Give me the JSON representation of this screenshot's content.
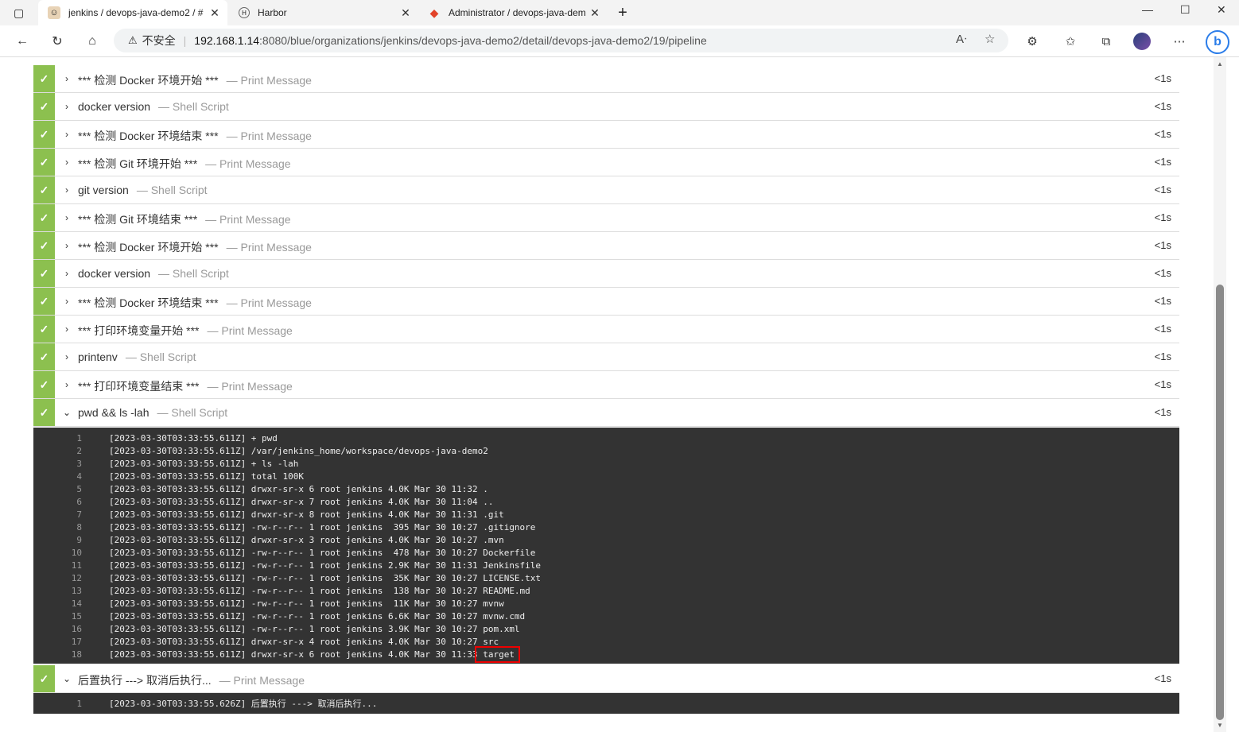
{
  "browser": {
    "tabs": [
      {
        "title": "jenkins / devops-java-demo2 / #",
        "close": "✕"
      },
      {
        "title": "Harbor",
        "close": "✕"
      },
      {
        "title": "Administrator / devops-java-dem",
        "close": "✕"
      }
    ],
    "new_tab": "+",
    "address": {
      "warning_icon": "warning-icon",
      "insecure_label": "不安全",
      "host": "192.168.1.14",
      "path": ":8080/blue/organizations/jenkins/devops-java-demo2/detail/devops-java-demo2/19/pipeline"
    }
  },
  "pipeline": {
    "steps": [
      {
        "label": "*** 检测 Docker 环境开始 ***",
        "type": "— Print Message",
        "duration": "<1s",
        "expanded": false
      },
      {
        "label": "docker version",
        "type": "— Shell Script",
        "duration": "<1s",
        "expanded": false
      },
      {
        "label": "*** 检测 Docker 环境结束 ***",
        "type": "— Print Message",
        "duration": "<1s",
        "expanded": false
      },
      {
        "label": "*** 检测 Git 环境开始 ***",
        "type": "— Print Message",
        "duration": "<1s",
        "expanded": false
      },
      {
        "label": "git version",
        "type": "— Shell Script",
        "duration": "<1s",
        "expanded": false
      },
      {
        "label": "*** 检测 Git 环境结束 ***",
        "type": "— Print Message",
        "duration": "<1s",
        "expanded": false
      },
      {
        "label": "*** 检测 Docker 环境开始 ***",
        "type": "— Print Message",
        "duration": "<1s",
        "expanded": false
      },
      {
        "label": "docker version",
        "type": "— Shell Script",
        "duration": "<1s",
        "expanded": false
      },
      {
        "label": "*** 检测 Docker 环境结束 ***",
        "type": "— Print Message",
        "duration": "<1s",
        "expanded": false
      },
      {
        "label": "*** 打印环境变量开始 ***",
        "type": "— Print Message",
        "duration": "<1s",
        "expanded": false
      },
      {
        "label": "printenv",
        "type": "— Shell Script",
        "duration": "<1s",
        "expanded": false
      },
      {
        "label": "*** 打印环境变量结束 ***",
        "type": "— Print Message",
        "duration": "<1s",
        "expanded": false
      },
      {
        "label": "pwd && ls -lah",
        "type": "— Shell Script",
        "duration": "<1s",
        "expanded": true
      },
      {
        "label": "后置执行 ---> 取消后执行...",
        "type": "— Print Message",
        "duration": "<1s",
        "expanded": true
      }
    ],
    "log1": [
      {
        "n": "1",
        "t": "[2023-03-30T03:33:55.611Z] + pwd"
      },
      {
        "n": "2",
        "t": "[2023-03-30T03:33:55.611Z] /var/jenkins_home/workspace/devops-java-demo2"
      },
      {
        "n": "3",
        "t": "[2023-03-30T03:33:55.611Z] + ls -lah"
      },
      {
        "n": "4",
        "t": "[2023-03-30T03:33:55.611Z] total 100K"
      },
      {
        "n": "5",
        "t": "[2023-03-30T03:33:55.611Z] drwxr-sr-x 6 root jenkins 4.0K Mar 30 11:32 ."
      },
      {
        "n": "6",
        "t": "[2023-03-30T03:33:55.611Z] drwxr-sr-x 7 root jenkins 4.0K Mar 30 11:04 .."
      },
      {
        "n": "7",
        "t": "[2023-03-30T03:33:55.611Z] drwxr-sr-x 8 root jenkins 4.0K Mar 30 11:31 .git"
      },
      {
        "n": "8",
        "t": "[2023-03-30T03:33:55.611Z] -rw-r--r-- 1 root jenkins  395 Mar 30 10:27 .gitignore"
      },
      {
        "n": "9",
        "t": "[2023-03-30T03:33:55.611Z] drwxr-sr-x 3 root jenkins 4.0K Mar 30 10:27 .mvn"
      },
      {
        "n": "10",
        "t": "[2023-03-30T03:33:55.611Z] -rw-r--r-- 1 root jenkins  478 Mar 30 10:27 Dockerfile"
      },
      {
        "n": "11",
        "t": "[2023-03-30T03:33:55.611Z] -rw-r--r-- 1 root jenkins 2.9K Mar 30 11:31 Jenkinsfile"
      },
      {
        "n": "12",
        "t": "[2023-03-30T03:33:55.611Z] -rw-r--r-- 1 root jenkins  35K Mar 30 10:27 LICENSE.txt"
      },
      {
        "n": "13",
        "t": "[2023-03-30T03:33:55.611Z] -rw-r--r-- 1 root jenkins  138 Mar 30 10:27 README.md"
      },
      {
        "n": "14",
        "t": "[2023-03-30T03:33:55.611Z] -rw-r--r-- 1 root jenkins  11K Mar 30 10:27 mvnw"
      },
      {
        "n": "15",
        "t": "[2023-03-30T03:33:55.611Z] -rw-r--r-- 1 root jenkins 6.6K Mar 30 10:27 mvnw.cmd"
      },
      {
        "n": "16",
        "t": "[2023-03-30T03:33:55.611Z] -rw-r--r-- 1 root jenkins 3.9K Mar 30 10:27 pom.xml"
      },
      {
        "n": "17",
        "t": "[2023-03-30T03:33:55.611Z] drwxr-sr-x 4 root jenkins 4.0K Mar 30 10:27 src"
      },
      {
        "n": "18",
        "t": "[2023-03-30T03:33:55.611Z] drwxr-sr-x 6 root jenkins 4.0K Mar 30 11:33 target"
      }
    ],
    "log2": [
      {
        "n": "1",
        "t": "[2023-03-30T03:33:55.626Z] 后置执行 ---> 取消后执行..."
      }
    ]
  }
}
